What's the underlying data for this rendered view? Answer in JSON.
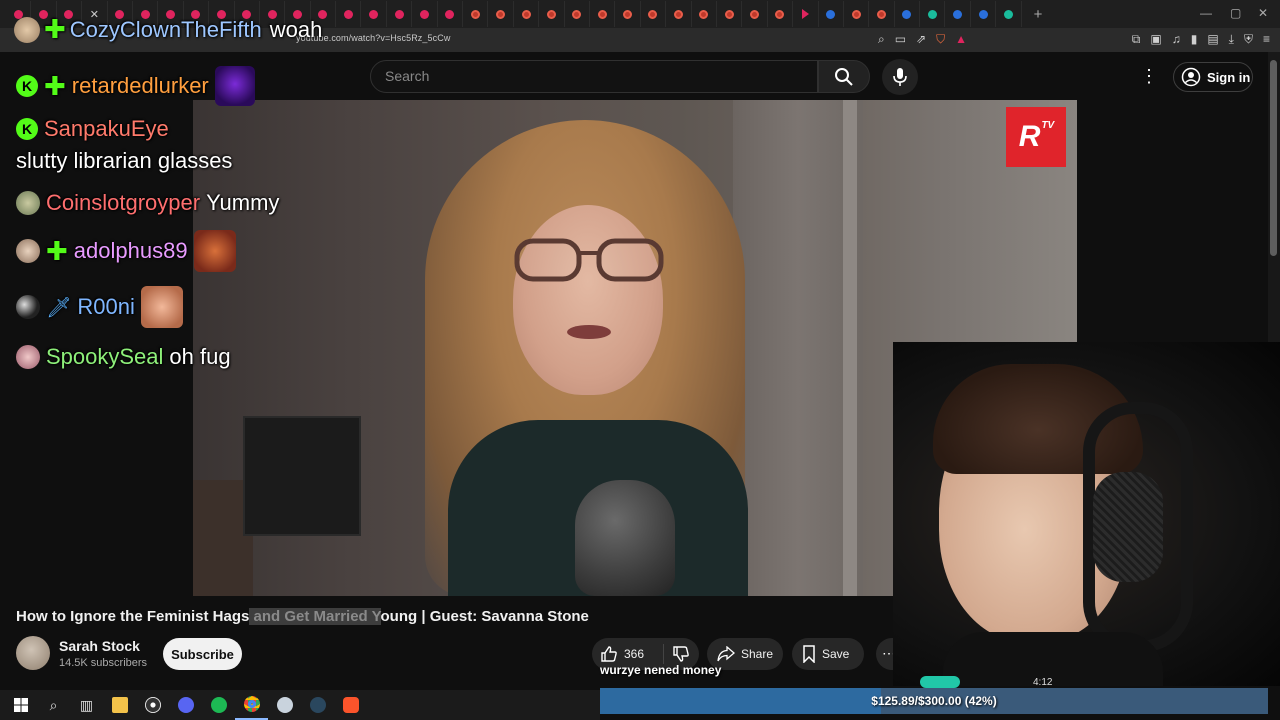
{
  "browser": {
    "url": "youtube.com/watch?v=Hsc5Rz_5cCw",
    "tab_count": 40
  },
  "youtube": {
    "search_placeholder": "Search",
    "signin_label": "Sign in",
    "video_title_pre": "How to Ignore the Feminist Hags",
    "video_title_hl": " and Get Married Y",
    "video_title_post": "oung | Guest: Savanna Stone",
    "channel_name": "Sarah Stock",
    "channel_subs": "14.5K subscribers",
    "subscribe_label": "Subscribe",
    "like_count": "366",
    "share_label": "Share",
    "save_label": "Save",
    "logo_text": "R",
    "logo_sup": "TV"
  },
  "chat": [
    {
      "user": "CozyClownTheFifth",
      "message": "woah",
      "user_color": "#9ec7ff"
    },
    {
      "user": "retardedlurker",
      "message": "",
      "user_color": "#ff9f3f"
    },
    {
      "user": "SanpakuEye",
      "message": "",
      "user_color": "#ff7a6b"
    },
    {
      "user": "",
      "message": "slutty librarian glasses",
      "user_color": "#ffffff"
    },
    {
      "user": "Coinslotgroyper",
      "message": "Yummy",
      "user_color": "#ff6f6f"
    },
    {
      "user": "adolphus89",
      "message": "",
      "user_color": "#e89bff"
    },
    {
      "user": "R00ni",
      "message": "",
      "user_color": "#7fb6ff"
    },
    {
      "user": "SpookySeal",
      "message": "oh fug",
      "user_color": "#8ef07a"
    }
  ],
  "stream": {
    "caption": "wurzye nened money",
    "donation_text": "$125.89/$300.00 (42%)",
    "donation_fraction": 0.42,
    "timer": "4:12"
  },
  "colors": {
    "kick_green": "#53fc18",
    "yt_bg": "#0f0f0f",
    "donation_blue": "#2d6aa0"
  }
}
